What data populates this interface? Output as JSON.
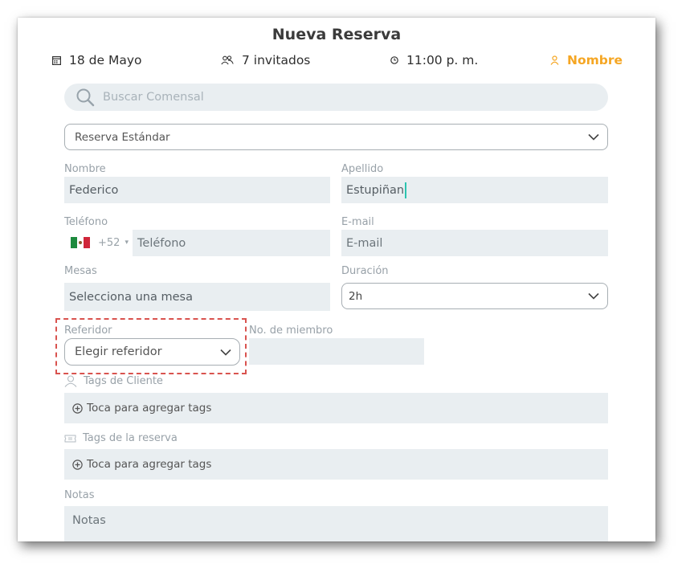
{
  "header": {
    "title": "Nueva Reserva",
    "date": "18 de Mayo",
    "guests": "7 invitados",
    "time": "11:00 p. m.",
    "name_tab": "Nombre",
    "accent_color": "#f5a623"
  },
  "search": {
    "placeholder": "Buscar Comensal"
  },
  "reservation_type": {
    "selected": "Reserva Estándar"
  },
  "form": {
    "first_name": {
      "label": "Nombre",
      "value": "Federico"
    },
    "last_name": {
      "label": "Apellido",
      "value": "Estupiñan"
    },
    "phone": {
      "label": "Teléfono",
      "country_code": "+52",
      "placeholder": "Teléfono"
    },
    "email": {
      "label": "E-mail",
      "placeholder": "E-mail"
    },
    "tables": {
      "label": "Mesas",
      "placeholder": "Selecciona una mesa"
    },
    "duration": {
      "label": "Duración",
      "selected": "2h"
    },
    "referrer": {
      "label": "Referidor",
      "selected": "Elegir referidor"
    },
    "member_number": {
      "label": "No. de miembro",
      "value": ""
    }
  },
  "client_tags": {
    "label": "Tags de Cliente",
    "add_text": "Toca para agregar tags"
  },
  "reservation_tags": {
    "label": "Tags de la reserva",
    "add_text": "Toca para agregar tags"
  },
  "notes": {
    "label": "Notas",
    "placeholder": "Notas"
  },
  "icons": [
    "calendar-icon",
    "people-icon",
    "clock-icon",
    "user-icon",
    "search-icon",
    "chevron-down-icon",
    "mexico-flag-icon",
    "plus-circle-icon",
    "ticket-icon"
  ]
}
